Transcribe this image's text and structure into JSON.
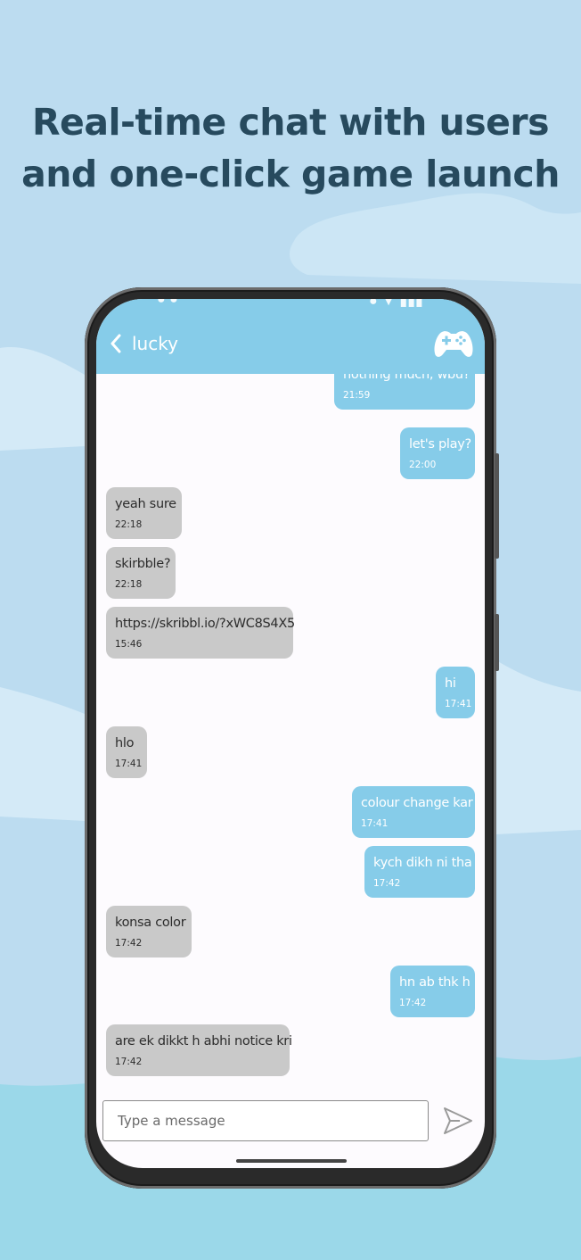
{
  "headline": {
    "line1": "Real-time chat with users",
    "line2": "and one-click game launch"
  },
  "colors": {
    "background": "#bcdcf0",
    "accent": "#86cce9",
    "received_bubble": "#c9c9c9",
    "headline": "#274a5e"
  },
  "app_bar": {
    "back_icon": "chevron-left-icon",
    "contact_name": "lucky",
    "game_icon": "gamepad-icon"
  },
  "messages": [
    {
      "side": "sent",
      "text": "nothing much, wbu?",
      "time": "21:59"
    },
    {
      "side": "sent",
      "text": "let's play?",
      "time": "22:00"
    },
    {
      "side": "received",
      "text": "yeah sure",
      "time": "22:18"
    },
    {
      "side": "received",
      "text": "skirbble?",
      "time": "22:18"
    },
    {
      "side": "received",
      "text": "https://skribbl.io/?xWC8S4X5",
      "time": "15:46"
    },
    {
      "side": "sent",
      "text": "hi",
      "time": "17:41"
    },
    {
      "side": "received",
      "text": "hlo",
      "time": "17:41"
    },
    {
      "side": "sent",
      "text": "colour change kar",
      "time": "17:41"
    },
    {
      "side": "sent",
      "text": "kych dikh ni tha",
      "time": "17:42"
    },
    {
      "side": "received",
      "text": "konsa color",
      "time": "17:42"
    },
    {
      "side": "sent",
      "text": "hn ab thk h",
      "time": "17:42"
    },
    {
      "side": "received",
      "text": "are ek dikkt h abhi notice kri",
      "time": "17:42"
    }
  ],
  "composer": {
    "placeholder": "Type a message",
    "send_icon": "send-icon"
  }
}
